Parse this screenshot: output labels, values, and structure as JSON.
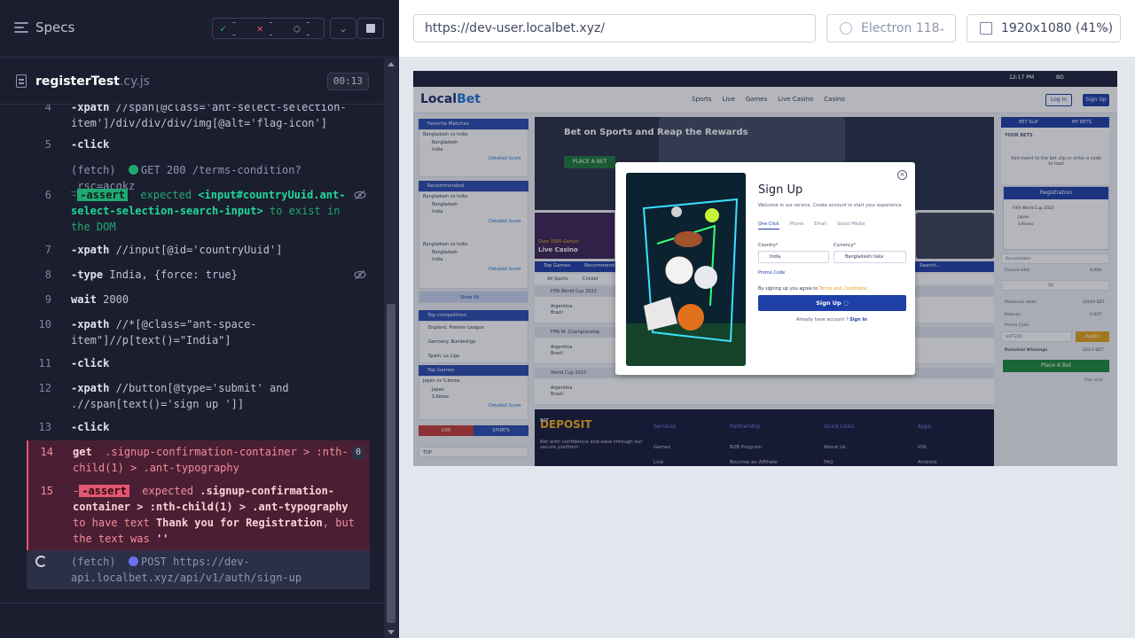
{
  "runner": {
    "specs_label": "Specs",
    "stats": {
      "passed": "--",
      "failed": "--",
      "pending": "--"
    },
    "spec": {
      "name": "registerTest",
      "ext": ".cy.js",
      "duration": "00:13"
    },
    "commands": [
      {
        "num": "4",
        "name": "-xpath",
        "text": "//span[@class='ant-select-selection-item']/div/div/div/img[@alt='flag-icon']"
      },
      {
        "num": "5",
        "name": "-click",
        "text": ""
      },
      {
        "num": "",
        "name": "(fetch)",
        "method": "GET 200",
        "text": "/terms-condition?_rsc=acgkz"
      },
      {
        "num": "6",
        "name": "-assert",
        "pre": "expected",
        "subject": "<input#countryUuid.ant-select-selection-search-input>",
        "post": "to exist in the DOM"
      },
      {
        "num": "7",
        "name": "-xpath",
        "text": "//input[@id='countryUuid']"
      },
      {
        "num": "8",
        "name": "-type",
        "text": "India, {force: true}"
      },
      {
        "num": "9",
        "name": "wait",
        "text": "2000"
      },
      {
        "num": "10",
        "name": "-xpath",
        "text": "//*[@class=\"ant-space-item\"]//p[text()=\"India\"]"
      },
      {
        "num": "11",
        "name": "-click",
        "text": ""
      },
      {
        "num": "12",
        "name": "-xpath",
        "text": "//button[@type='submit' and .//span[text()='sign up ']]"
      },
      {
        "num": "13",
        "name": "-click",
        "text": ""
      },
      {
        "num": "14",
        "name": "get",
        "text": ".signup-confirmation-container > :nth-child(1) > .ant-typography",
        "badge": "0"
      },
      {
        "num": "15",
        "name": "-assert",
        "pre": "expected",
        "subject": ".signup-confirmation-container > :nth-child(1) > .ant-typography",
        "mid": "to have text",
        "expected": "Thank you for Registration",
        "post": ", but the text was",
        "actual": "''"
      },
      {
        "num": "",
        "name": "(fetch)",
        "method": "POST",
        "text": "https://dev-api.localbet.xyz/api/v1/auth/sign-up"
      }
    ]
  },
  "aut": {
    "url": "https://dev-user.localbet.xyz/",
    "browser": "Electron 118",
    "viewport": "1920x1080",
    "scale": "(41%)"
  },
  "site": {
    "time": "12:17 PM",
    "currency": "BD",
    "logo_a": "Local",
    "logo_b": "Bet",
    "nav": [
      "Sports",
      "Live",
      "Games",
      "Live Casino",
      "Casino"
    ],
    "login": "Log In",
    "signup": "Sign Up",
    "left": {
      "favorite": "Favorite Matches",
      "recommended": "Recommended",
      "top_competition": "Top competition",
      "top_games": "Top Games",
      "match": "Bangladesh vs India",
      "team_a": "Bangladesh",
      "team_b": "India",
      "detailed": "Detailed Score",
      "show_all": "Show All",
      "leagues": [
        "England. Premier League",
        "Germany. Bundesliga",
        "Spain. La Liga"
      ],
      "game_match": "Japan vs S.korea",
      "game_a": "Japan",
      "game_b": "S.Korea",
      "live": "LIVE",
      "sports": "SPORTS",
      "top": "TOP"
    },
    "banner": {
      "title": "Bet on Sports and Reap the Rewards",
      "button": "PLACE A BET"
    },
    "casino": {
      "tag": "Over 3000 Games",
      "title": "Live Casino"
    },
    "tabs": {
      "top_games": "Top Games",
      "recommended": "Recommended",
      "all_sports": "All Sports",
      "cricket": "Cricket",
      "search": "Search..."
    },
    "competitions": [
      "FIFA World Cup 2023",
      "FIFA W. Championship",
      "World Cup 2023"
    ],
    "teams": [
      "Argentina",
      "Brazil"
    ],
    "footer": {
      "brand_a": "BIT",
      "brand_b": "DEPOSIT",
      "tagline": "Bet with confidence and ease through our secure platform.",
      "services": "Services",
      "partnership": "Partnership",
      "quick_links": "Quick Links",
      "apps": "Apps",
      "games": "Games",
      "b2b": "B2B Program",
      "about": "About Us",
      "ios": "IOS",
      "live": "Live",
      "affiliate": "Become an Affiliate",
      "faq": "FAQ",
      "android": "Android"
    },
    "betslip": {
      "tab1": "BET SLIP",
      "tab2": "MY BETS",
      "your_bets": "YOUR BETS",
      "empty": "Add event to the bet slip or enter a code to load",
      "registration": "Registration",
      "event": "FIFA World Cup 2023",
      "team_a": "Japan",
      "team_b": "S.Korea",
      "accumulator": "Accumulator",
      "overall": "Overall odds",
      "overall_val": "4.056",
      "stake": "50",
      "max_stake": "Maximum stake",
      "max_val": "20000 BDT",
      "balance": "Balance",
      "balance_val": "0 BDT",
      "promo": "Promo Code",
      "promo_val": "GIFT220",
      "apply": "Apply",
      "potential": "Potential Winnings",
      "potential_val": "203.6 BDT",
      "place_bet": "Place A Bet",
      "one_click": "One click"
    },
    "modal": {
      "title": "Sign Up",
      "subtitle": "Welcome in our service, Create account to start your experience",
      "tabs": [
        "One Click",
        "Phone",
        "Email",
        "Social Media"
      ],
      "country_label": "Country*",
      "country": "India",
      "currency_label": "Currency*",
      "currency": "Bangladeshi taka",
      "promo": "Promo Code",
      "terms_pre": "By signing up you agree to",
      "terms_link": "Terms and Conditions",
      "button": "Sign Up",
      "already": "Already have account ?",
      "signin": "Sign In"
    }
  }
}
